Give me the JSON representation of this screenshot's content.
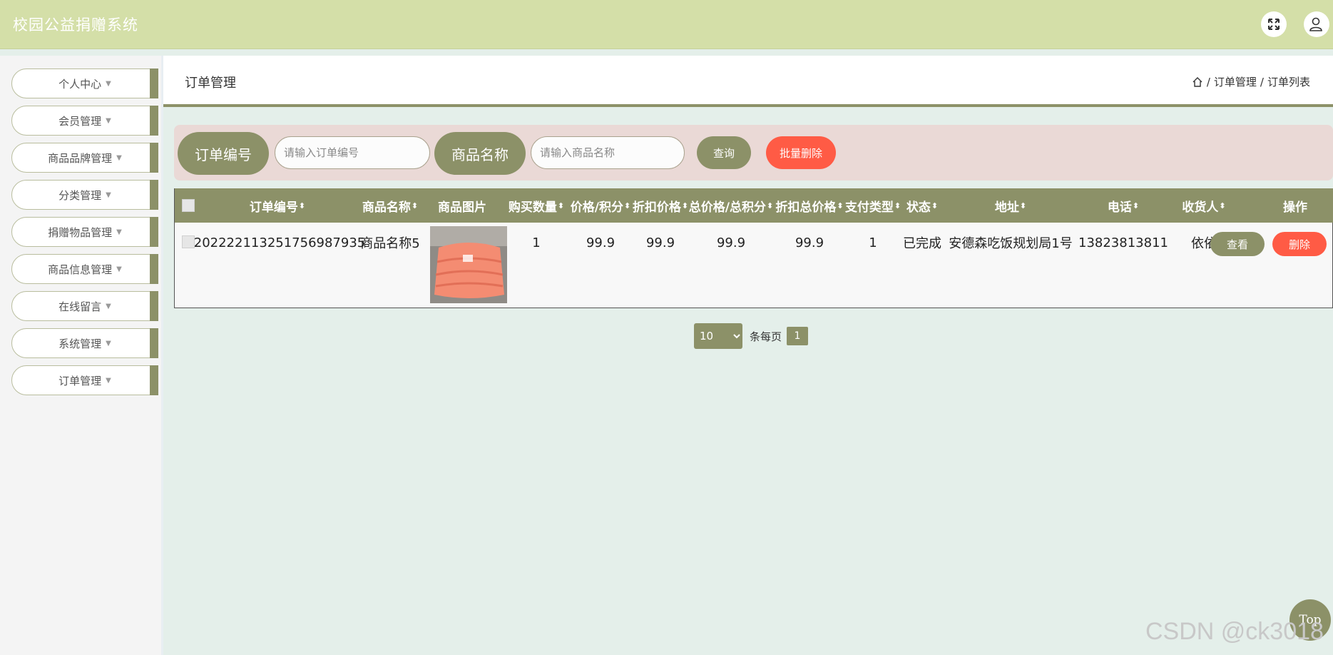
{
  "app": {
    "title": "校园公益捐赠系统"
  },
  "topbar": {
    "fullscreen_icon": "expand-icon",
    "user_icon": "user-icon"
  },
  "sidebar": {
    "items": [
      {
        "label": "个人中心"
      },
      {
        "label": "会员管理"
      },
      {
        "label": "商品品牌管理"
      },
      {
        "label": "分类管理"
      },
      {
        "label": "捐赠物品管理"
      },
      {
        "label": "商品信息管理"
      },
      {
        "label": "在线留言"
      },
      {
        "label": "系统管理"
      },
      {
        "label": "订单管理"
      }
    ]
  },
  "header": {
    "title": "订单管理",
    "breadcrumb": {
      "sep": "/",
      "level1": "订单管理",
      "level2": "订单列表"
    }
  },
  "search": {
    "order_label": "订单编号",
    "order_placeholder": "请输入订单编号",
    "order_value": "",
    "product_label": "商品名称",
    "product_placeholder": "请输入商品名称",
    "product_value": "",
    "query_button": "查询",
    "batch_delete_button": "批量删除"
  },
  "table": {
    "headers": {
      "order_no": "订单编号",
      "product_name": "商品名称",
      "product_image": "商品图片",
      "quantity": "购买数量",
      "price": "价格/积分",
      "discount_price": "折扣价格",
      "total": "总价格/总积分",
      "discount_total": "折扣总价格",
      "pay_type": "支付类型",
      "status": "状态",
      "address": "地址",
      "phone": "电话",
      "receiver": "收货人",
      "actions": "操作"
    },
    "rows": [
      {
        "order_no": "202222113251756987935",
        "product_name": "商品名称5",
        "quantity": "1",
        "price": "99.9",
        "discount_price": "99.9",
        "total": "99.9",
        "discount_total": "99.9",
        "pay_type": "1",
        "status": "已完成",
        "address": "安德森吃饭规划局1号",
        "phone": "13823813811",
        "receiver": "依依",
        "view_button": "查看",
        "delete_button": "删除"
      }
    ]
  },
  "pagination": {
    "page_size": "10",
    "per_page_text": "条每页",
    "current_page": "1"
  },
  "colors": {
    "accent": "#8c9168",
    "danger": "#ff5b45",
    "topbar": "#d4dfa8",
    "search_panel": "#ead9d6"
  },
  "back_to_top": "Top",
  "watermark": "CSDN @ck3018"
}
